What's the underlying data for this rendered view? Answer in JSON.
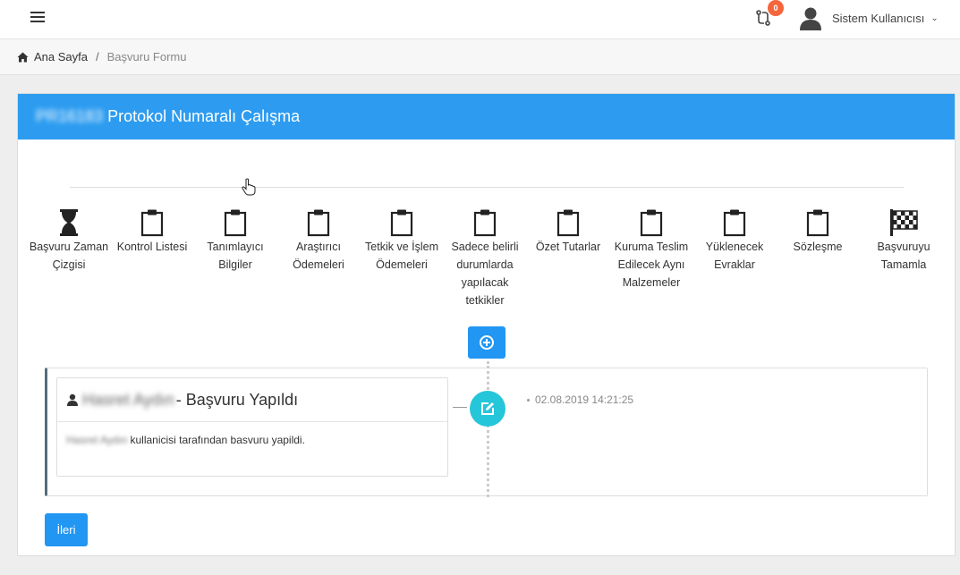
{
  "header": {
    "notification_count": "0",
    "user_name": "Sistem Kullanıcısı"
  },
  "breadcrumb": {
    "home": "Ana Sayfa",
    "separator": "/",
    "current": "Başvuru Formu"
  },
  "card": {
    "protocol_number": "PR16183",
    "title": "Protokol Numaralı Çalışma"
  },
  "steps": [
    {
      "label": "Başvuru Zaman Çizgisi",
      "icon": "hourglass-icon"
    },
    {
      "label": "Kontrol Listesi",
      "icon": "clipboard-icon"
    },
    {
      "label": "Tanımlayıcı Bilgiler",
      "icon": "clipboard-icon"
    },
    {
      "label": "Araştırıcı Ödemeleri",
      "icon": "clipboard-icon"
    },
    {
      "label": "Tetkik ve İşlem Ödemeleri",
      "icon": "clipboard-icon"
    },
    {
      "label": "Sadece belirli durumlarda yapılacak tetkikler",
      "icon": "clipboard-icon"
    },
    {
      "label": "Özet Tutarlar",
      "icon": "clipboard-icon"
    },
    {
      "label": "Kuruma Teslim Edilecek Aynı Malzemeler",
      "icon": "clipboard-icon"
    },
    {
      "label": "Yüklenecek Evraklar",
      "icon": "clipboard-icon"
    },
    {
      "label": "Sözleşme",
      "icon": "clipboard-icon"
    },
    {
      "label": "Başvuruyu Tamamla",
      "icon": "checkered-flag-icon"
    }
  ],
  "timeline": {
    "entry": {
      "user": "Hasret Aydın",
      "title": "- Başvuru Yapıldı",
      "user_short": "Hasret Aydın",
      "body": "kullanicisi tarafından basvuru yapildi.",
      "timestamp": "02.08.2019 14:21:25"
    }
  },
  "actions": {
    "next_label": "İleri"
  },
  "colors": {
    "primary": "#2196f3",
    "header_blue": "#2d9cf0",
    "badge_orange": "#f4663d",
    "timeline_teal": "#26c6da"
  }
}
